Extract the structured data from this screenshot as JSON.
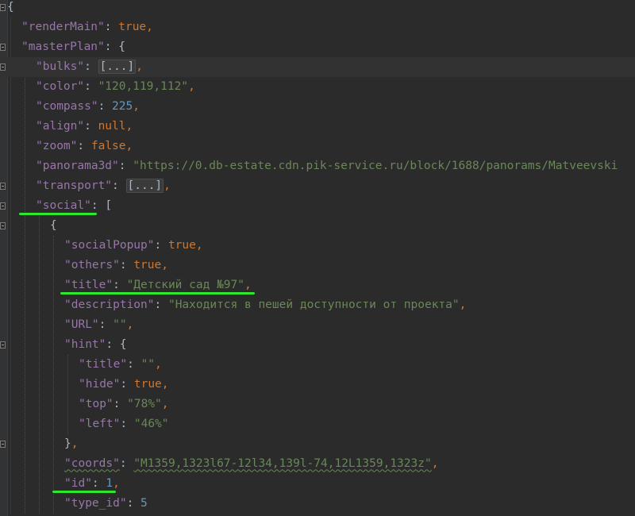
{
  "editor": {
    "lines": [
      {
        "indent": 0,
        "tokens": [
          {
            "t": "br",
            "v": "{"
          }
        ]
      },
      {
        "indent": 1,
        "tokens": [
          {
            "t": "key",
            "v": "\"renderMain\""
          },
          {
            "t": "col",
            "v": ": "
          },
          {
            "t": "kw",
            "v": "true"
          },
          {
            "t": "punc",
            "v": ","
          }
        ]
      },
      {
        "indent": 1,
        "tokens": [
          {
            "t": "key",
            "v": "\"masterPlan\""
          },
          {
            "t": "col",
            "v": ": "
          },
          {
            "t": "br",
            "v": "{"
          }
        ]
      },
      {
        "indent": 2,
        "tokens": [
          {
            "t": "key",
            "v": "\"bulks\""
          },
          {
            "t": "col",
            "v": ": "
          },
          {
            "t": "folded",
            "v": "[...]"
          },
          {
            "t": "punc",
            "v": ","
          }
        ]
      },
      {
        "indent": 2,
        "tokens": [
          {
            "t": "key",
            "v": "\"color\""
          },
          {
            "t": "col",
            "v": ": "
          },
          {
            "t": "str",
            "v": "\"120,119,112\""
          },
          {
            "t": "punc",
            "v": ","
          }
        ]
      },
      {
        "indent": 2,
        "tokens": [
          {
            "t": "key",
            "v": "\"compass\""
          },
          {
            "t": "col",
            "v": ": "
          },
          {
            "t": "num",
            "v": "225"
          },
          {
            "t": "punc",
            "v": ","
          }
        ]
      },
      {
        "indent": 2,
        "tokens": [
          {
            "t": "key",
            "v": "\"align\""
          },
          {
            "t": "col",
            "v": ": "
          },
          {
            "t": "kw",
            "v": "null"
          },
          {
            "t": "punc",
            "v": ","
          }
        ]
      },
      {
        "indent": 2,
        "tokens": [
          {
            "t": "key",
            "v": "\"zoom\""
          },
          {
            "t": "col",
            "v": ": "
          },
          {
            "t": "kw",
            "v": "false"
          },
          {
            "t": "punc",
            "v": ","
          }
        ]
      },
      {
        "indent": 2,
        "tokens": [
          {
            "t": "key",
            "v": "\"panorama3d\""
          },
          {
            "t": "col",
            "v": ": "
          },
          {
            "t": "str",
            "v": "\"https://0.db-estate.cdn.pik-service.ru/block/1688/panorams/Matveevski"
          }
        ]
      },
      {
        "indent": 2,
        "tokens": [
          {
            "t": "key",
            "v": "\"transport\""
          },
          {
            "t": "col",
            "v": ": "
          },
          {
            "t": "folded",
            "v": "[...]"
          },
          {
            "t": "punc",
            "v": ","
          }
        ]
      },
      {
        "indent": 2,
        "tokens": [
          {
            "t": "key",
            "v": "\"social\""
          },
          {
            "t": "col",
            "v": ": "
          },
          {
            "t": "br",
            "v": "["
          }
        ]
      },
      {
        "indent": 3,
        "tokens": [
          {
            "t": "br",
            "v": "{"
          }
        ]
      },
      {
        "indent": 4,
        "tokens": [
          {
            "t": "key",
            "v": "\"socialPopup\""
          },
          {
            "t": "col",
            "v": ": "
          },
          {
            "t": "kw",
            "v": "true"
          },
          {
            "t": "punc",
            "v": ","
          }
        ]
      },
      {
        "indent": 4,
        "tokens": [
          {
            "t": "key",
            "v": "\"others\""
          },
          {
            "t": "col",
            "v": ": "
          },
          {
            "t": "kw",
            "v": "true"
          },
          {
            "t": "punc",
            "v": ","
          }
        ]
      },
      {
        "indent": 4,
        "tokens": [
          {
            "t": "key",
            "v": "\"title\""
          },
          {
            "t": "col",
            "v": ": "
          },
          {
            "t": "str",
            "v": "\"Детский сад №97\""
          },
          {
            "t": "punc",
            "v": ","
          }
        ]
      },
      {
        "indent": 4,
        "tokens": [
          {
            "t": "key",
            "v": "\"description\""
          },
          {
            "t": "col",
            "v": ": "
          },
          {
            "t": "str",
            "v": "\"Находится в пешей доступности от проекта\""
          },
          {
            "t": "punc",
            "v": ","
          }
        ]
      },
      {
        "indent": 4,
        "tokens": [
          {
            "t": "key",
            "v": "\"URL\""
          },
          {
            "t": "col",
            "v": ": "
          },
          {
            "t": "str",
            "v": "\"\""
          },
          {
            "t": "punc",
            "v": ","
          }
        ]
      },
      {
        "indent": 4,
        "tokens": [
          {
            "t": "key",
            "v": "\"hint\""
          },
          {
            "t": "col",
            "v": ": "
          },
          {
            "t": "br",
            "v": "{"
          }
        ]
      },
      {
        "indent": 5,
        "tokens": [
          {
            "t": "key",
            "v": "\"title\""
          },
          {
            "t": "col",
            "v": ": "
          },
          {
            "t": "str",
            "v": "\"\""
          },
          {
            "t": "punc",
            "v": ","
          }
        ]
      },
      {
        "indent": 5,
        "tokens": [
          {
            "t": "key",
            "v": "\"hide\""
          },
          {
            "t": "col",
            "v": ": "
          },
          {
            "t": "kw",
            "v": "true"
          },
          {
            "t": "punc",
            "v": ","
          }
        ]
      },
      {
        "indent": 5,
        "tokens": [
          {
            "t": "key",
            "v": "\"top\""
          },
          {
            "t": "col",
            "v": ": "
          },
          {
            "t": "str",
            "v": "\"78%\""
          },
          {
            "t": "punc",
            "v": ","
          }
        ]
      },
      {
        "indent": 5,
        "tokens": [
          {
            "t": "key",
            "v": "\"left\""
          },
          {
            "t": "col",
            "v": ": "
          },
          {
            "t": "str",
            "v": "\"46%\""
          }
        ]
      },
      {
        "indent": 4,
        "tokens": [
          {
            "t": "br",
            "v": "}"
          },
          {
            "t": "punc",
            "v": ","
          }
        ]
      },
      {
        "indent": 4,
        "tokens": [
          {
            "t": "key",
            "v": "\"coords\""
          },
          {
            "t": "col",
            "v": ": "
          },
          {
            "t": "str",
            "v": "\"M1359,1323l67-12l34,139l-74,12L1359,1323z\""
          },
          {
            "t": "punc",
            "v": ","
          }
        ]
      },
      {
        "indent": 4,
        "tokens": [
          {
            "t": "key",
            "v": "\"id\""
          },
          {
            "t": "col",
            "v": ": "
          },
          {
            "t": "num",
            "v": "1"
          },
          {
            "t": "punc",
            "v": ","
          }
        ]
      },
      {
        "indent": 4,
        "tokens": [
          {
            "t": "key",
            "v": "\"type_id\""
          },
          {
            "t": "col",
            "v": ": "
          },
          {
            "t": "num",
            "v": "5"
          }
        ]
      }
    ],
    "fold_lines": [
      0,
      2,
      3,
      9,
      10,
      11,
      17,
      22
    ],
    "highlight_color": "#2ee82e",
    "annotations": [
      {
        "line": 10,
        "name": "social-key-underline"
      },
      {
        "line": 14,
        "name": "title-key-underline"
      },
      {
        "line": 24,
        "name": "id-key-underline"
      }
    ]
  }
}
